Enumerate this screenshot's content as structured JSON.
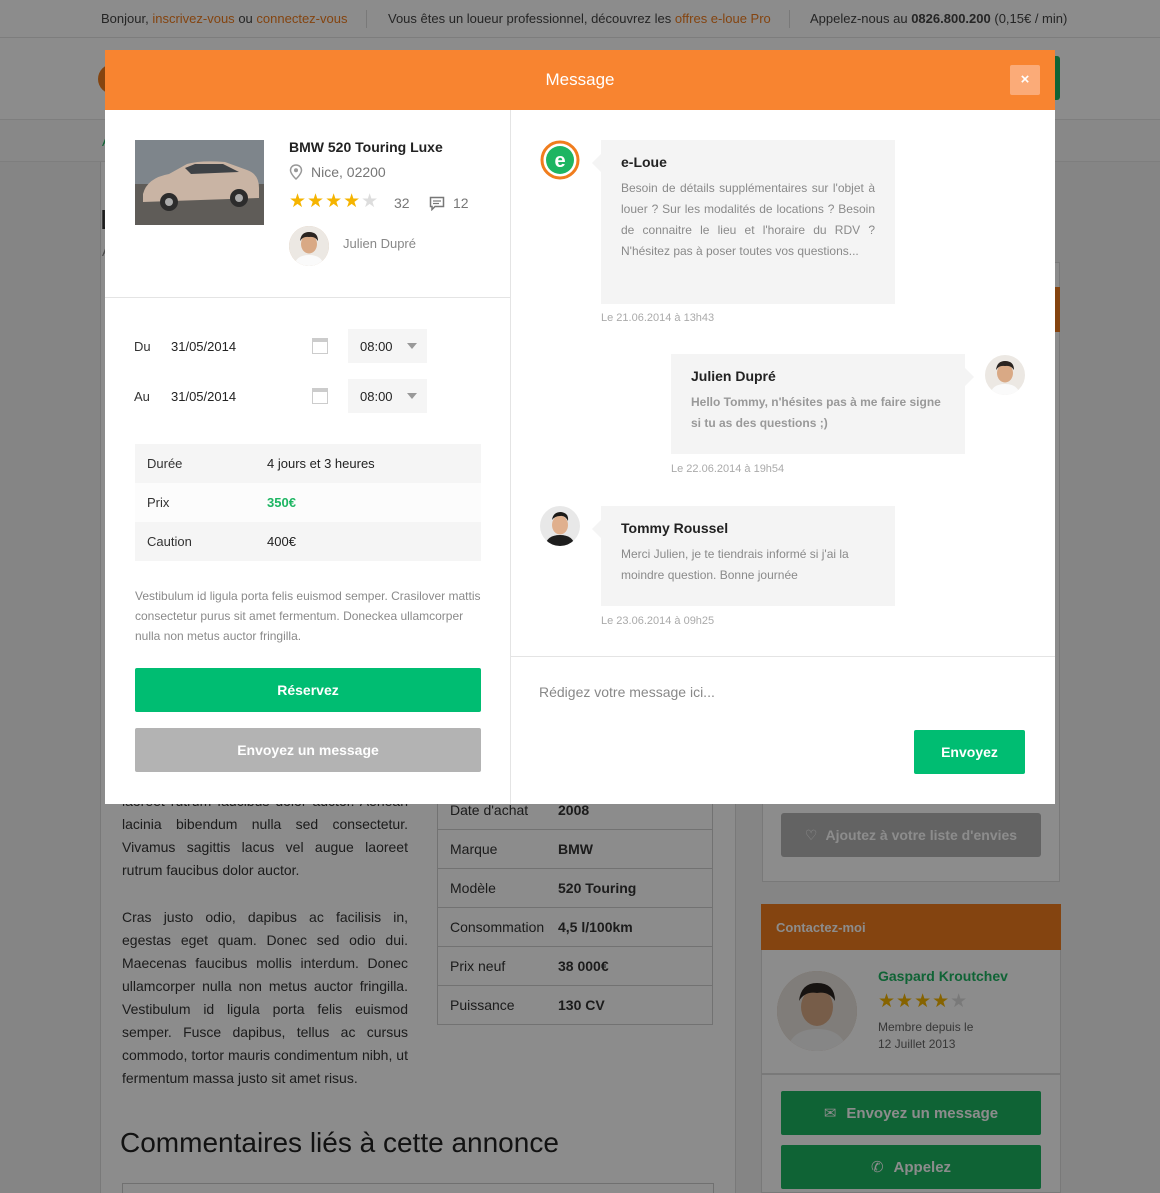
{
  "topbar": {
    "hello": "Bonjour,",
    "signup": "inscrivez-vous",
    "or": "ou",
    "login": "connectez-vous",
    "pro_text": "Vous êtes un loueur professionnel, découvrez les",
    "pro_link": "offres e-loue Pro",
    "call_text": "Appelez-nous au",
    "phone": "0826.800.200",
    "rate": "(0,15€ / min)"
  },
  "background": {
    "title_initial": "L",
    "subtitle_initial": "A",
    "crumb_initial": "A",
    "paragraph1": "laoreet rutrum faucibus dolor auctor. Aenean lacinia bibendum nulla sed consectetur. Vivamus sagittis lacus vel augue laoreet rutrum faucibus dolor auctor.",
    "paragraph2": "Cras justo odio, dapibus ac facilisis in, egestas eget quam. Donec sed odio dui. Maecenas faucibus mollis interdum. Donec ullamcorper nulla non metus auctor fringilla. Vestibulum id ligula porta felis euismod semper. Fusce dapibus, tellus ac cursus commodo, tortor mauris condimentum nibh, ut fermentum massa justo sit amet risus.",
    "specs": [
      {
        "k": "Date d'achat",
        "v": "2008"
      },
      {
        "k": "Marque",
        "v": "BMW"
      },
      {
        "k": "Modèle",
        "v": "520 Touring"
      },
      {
        "k": "Consommation",
        "v": "4,5 l/100km"
      },
      {
        "k": "Prix neuf",
        "v": "38 000€"
      },
      {
        "k": "Puissance",
        "v": "130 CV"
      }
    ],
    "comments_title": "Commentaires liés à cette annonce",
    "wishlist": "Ajoutez à votre liste d'envies",
    "contact_title": "Contactez-moi",
    "contact_name": "Gaspard Kroutchev",
    "contact_rating": 4,
    "member_since_1": "Membre depuis le",
    "member_since_2": "12 Juillet 2013",
    "send_message": "Envoyez un message",
    "call": "Appelez"
  },
  "modal": {
    "title": "Message",
    "close": "×",
    "product": {
      "name": "BMW 520 Touring Luxe",
      "location": "Nice, 02200",
      "rating": 4,
      "reviews": "32",
      "comments": "12",
      "owner": "Julien Dupré"
    },
    "dates": [
      {
        "label": "Du",
        "date": "31/05/2014",
        "time": "08:00"
      },
      {
        "label": "Au",
        "date": "31/05/2014",
        "time": "08:00"
      }
    ],
    "summary": [
      {
        "k": "Durée",
        "v": "4 jours et 3 heures"
      },
      {
        "k": "Prix",
        "v": "350€"
      },
      {
        "k": "Caution",
        "v": "400€"
      }
    ],
    "description": "Vestibulum id ligula porta felis euismod semper. Crasilover mattis consectetur purus sit amet fermentum. Doneckea ullamcorper nulla non metus auctor fringilla.",
    "reserve": "Réservez",
    "send_message": "Envoyez un message",
    "messages": [
      {
        "name": "e-Loue",
        "text": "Besoin de détails supplémentaires sur l'objet à louer ? Sur les modalités de locations ? Besoin de connaitre le lieu et l'horaire du RDV ? N'hésitez pas à poser toutes vos questions...",
        "time": "Le 21.06.2014 à 13h43"
      },
      {
        "name": "Julien Dupré",
        "text": "Hello Tommy, n'hésites pas à me faire signe si tu as des questions ;)",
        "time": "Le 22.06.2014 à 19h54"
      },
      {
        "name": "Tommy Roussel",
        "text": "Merci Julien, je te tiendrais informé si j'ai la moindre question. Bonne journée",
        "time": "Le 23.06.2014 à 09h25"
      }
    ],
    "input_placeholder": "Rédigez votre message ici...",
    "send": "Envoyez"
  },
  "colors": {
    "orange": "#f88430",
    "green": "#00bd72",
    "star": "#f5b400"
  }
}
